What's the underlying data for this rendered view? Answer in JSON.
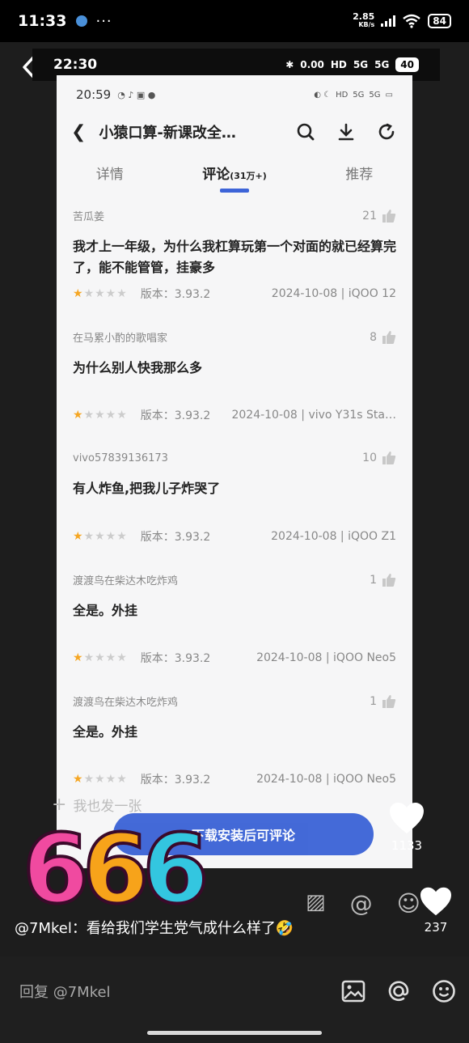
{
  "status_bar": {
    "time": "11:33",
    "more": "···",
    "speed_top": "2.85",
    "speed_bottom": "KB/s",
    "battery": "84"
  },
  "inner_status": {
    "time": "22:30",
    "net": "0.00",
    "battery": "40"
  },
  "app": {
    "status_time": "20:59",
    "title": "小猿口算-新课改全…",
    "tabs": {
      "details": "详情",
      "comments": "评论",
      "comments_count": "(31万+)",
      "recommend": "推荐"
    },
    "reviews": [
      {
        "user": "苦瓜姜",
        "likes": "21",
        "text": "我才上一年级，为什么我杠算玩第一个对面的就已经算完了，能不能管管，挂豪多",
        "version": "版本：3.93.2",
        "date": "2024-10-08 | iQOO 12"
      },
      {
        "user": "在马累小酌的歌唱家",
        "likes": "8",
        "text": "为什么别人快我那么多",
        "version": "版本：3.93.2",
        "date": "2024-10-08 | vivo Y31s Sta…"
      },
      {
        "user": "vivo57839136173",
        "likes": "10",
        "text": "有人炸鱼,把我儿子炸哭了",
        "version": "版本：3.93.2",
        "date": "2024-10-08 | iQOO Z1"
      },
      {
        "user": "渡渡鸟在柴达木吃炸鸡",
        "likes": "1",
        "text": "全是。外挂",
        "version": "版本：3.93.2",
        "date": "2024-10-08 | iQOO Neo5"
      },
      {
        "user": "渡渡鸟在柴达木吃炸鸡",
        "likes": "1",
        "text": "全是。外挂",
        "version": "版本：3.93.2",
        "date": "2024-10-08 | iQOO Neo5"
      }
    ],
    "ghost_input": "我也发一张",
    "download_button": "下载安装后可评论"
  },
  "sticker_text": "666",
  "like_count_video": "1133",
  "like_count_comment": "237",
  "comment": {
    "text": "@7Mkel：看给我们学生党气成什么样了🤣"
  },
  "reply_placeholder": "回复 @7Mkel",
  "colors": {
    "accent": "#3a62d6",
    "star": "#f5a623",
    "background": "#000000"
  }
}
